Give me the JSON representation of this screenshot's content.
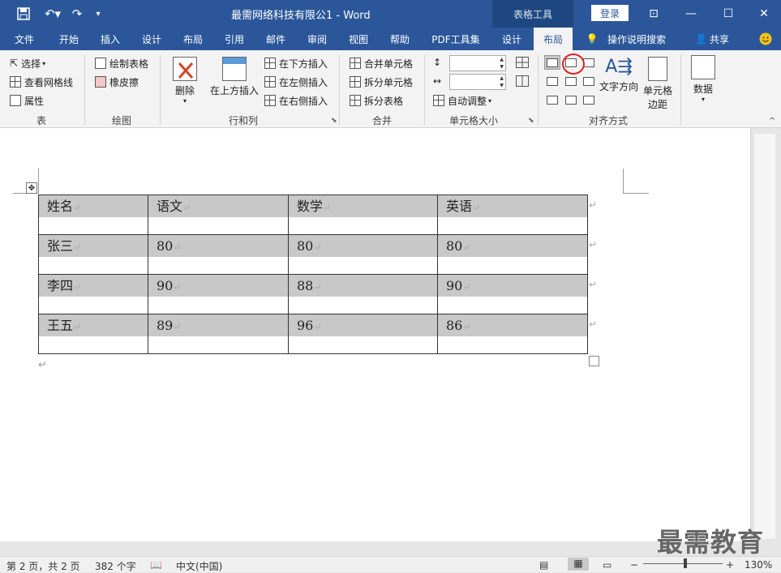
{
  "titlebar": {
    "save_icon": "save-icon",
    "undo_icon": "undo-icon",
    "redo_icon": "redo-icon",
    "customize_icon": "customize-icon",
    "title": "最需网络科技有限公1  -  Word",
    "context_tab": "表格工具",
    "login": "登录",
    "ribbon_display_icon": "ribbon-display-icon",
    "minimize_icon": "minimize-icon",
    "maximize_icon": "maximize-icon",
    "close_icon": "close-icon"
  },
  "tabs": [
    "文件",
    "开始",
    "插入",
    "设计",
    "布局",
    "引用",
    "邮件",
    "审阅",
    "视图",
    "帮助",
    "PDF工具集",
    "设计",
    "布局"
  ],
  "active_tab": "布局",
  "tell_me": "操作说明搜索",
  "share": "共享",
  "ribbon": {
    "table_group": {
      "select": "选择",
      "view_gridlines": "查看网格线",
      "properties": "属性",
      "label": "表"
    },
    "draw_group": {
      "draw_table": "绘制表格",
      "eraser": "橡皮擦",
      "label": "绘图"
    },
    "rows_cols_group": {
      "delete": "删除",
      "insert_above": "在上方插入",
      "insert_below": "在下方插入",
      "insert_left": "在左侧插入",
      "insert_right": "在右侧插入",
      "label": "行和列"
    },
    "merge_group": {
      "merge_cells": "合并单元格",
      "split_cells": "拆分单元格",
      "split_table": "拆分表格",
      "label": "合并"
    },
    "cell_size_group": {
      "height_value": "",
      "width_value": "",
      "autofit": "自动调整",
      "label": "单元格大小"
    },
    "alignment_group": {
      "text_direction": "文字方向",
      "cell_margins_line1": "单元格",
      "cell_margins_line2": "边距",
      "label": "对齐方式"
    },
    "data_group": {
      "data": "数据"
    }
  },
  "table": {
    "header": [
      "姓名",
      "语文",
      "数学",
      "英语"
    ],
    "rows": [
      [
        "张三",
        "80",
        "80",
        "80"
      ],
      [
        "李四",
        "90",
        "88",
        "90"
      ],
      [
        "王五",
        "89",
        "96",
        "86"
      ]
    ]
  },
  "statusbar": {
    "page": "第 2 页，共 2 页",
    "words": "382 个字",
    "language": "中文(中国)",
    "zoom": "130%",
    "zoom_minus": "−",
    "zoom_plus": "+"
  },
  "watermark": "最需教育",
  "colors": {
    "brand": "#2b579a",
    "selection": "#c8c8c8",
    "highlight_circle": "#e02020"
  }
}
